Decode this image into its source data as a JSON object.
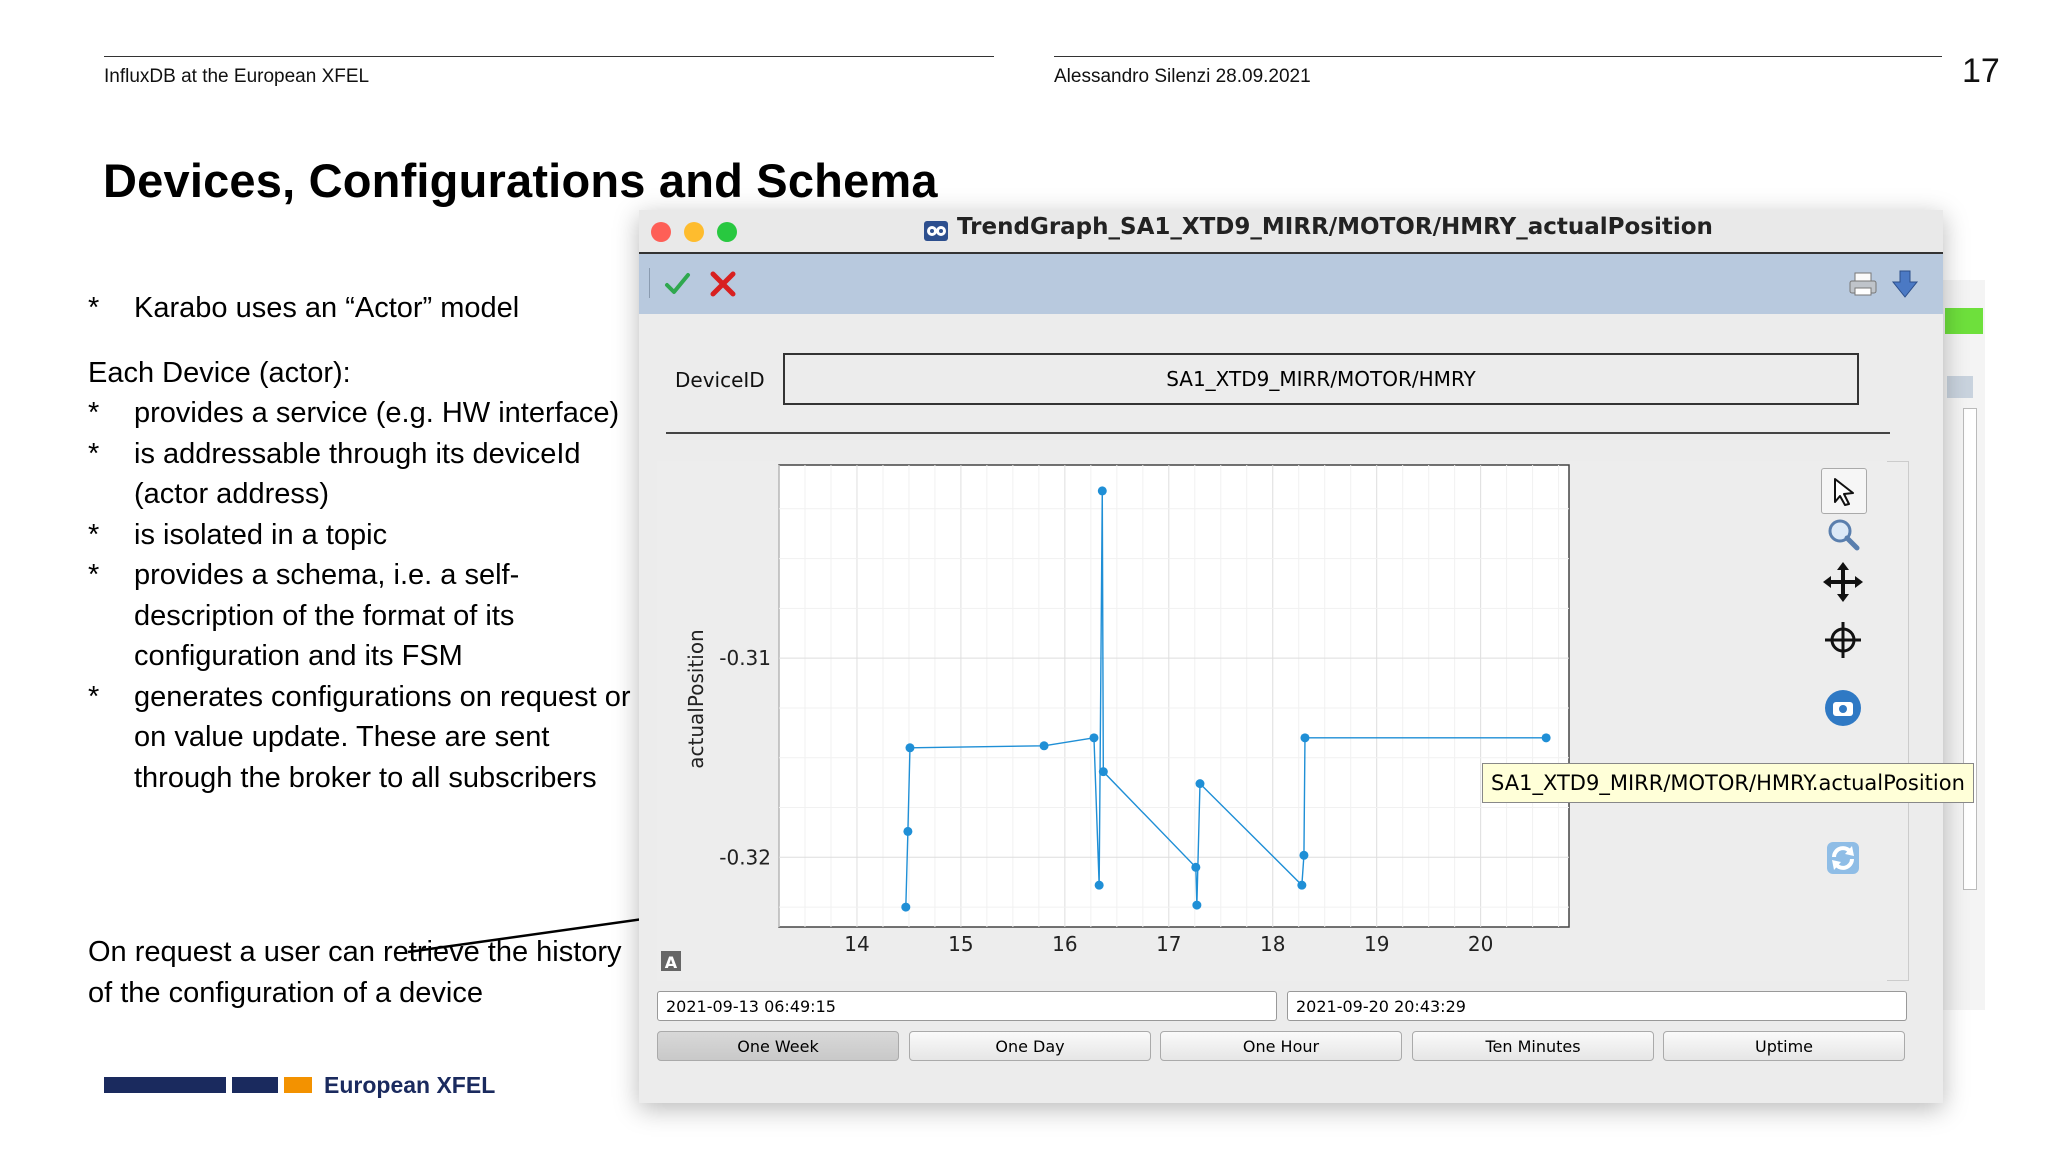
{
  "slide": {
    "header_left": "InfluxDB at the European XFEL",
    "header_right": "Alessandro Silenzi 28.09.2021",
    "page_number": "17",
    "title": "Devices, Configurations and Schema",
    "bullets": [
      {
        "marker": "*",
        "text": "Karabo uses an “Actor” model"
      },
      {
        "marker": "",
        "text": "Each Device (actor):"
      },
      {
        "marker": "*",
        "text": "provides a service (e.g. HW interface)"
      },
      {
        "marker": "*",
        "text": "is addressable through its deviceId (actor address)"
      },
      {
        "marker": "*",
        "text": "is isolated in a topic"
      },
      {
        "marker": "*",
        "text": "provides a schema, i.e. a self-description of the format of its configuration and its FSM"
      },
      {
        "marker": "*",
        "text": "generates configurations on request or on value update. These are sent through the broker to all subscribers"
      }
    ],
    "request_text": "On request a user can retrieve the history of the configuration of a device",
    "logo_text": "European XFEL",
    "logo_colors": {
      "navy": "#1a2a5e",
      "orange": "#f39200"
    }
  },
  "window": {
    "title": "TrendGraph_SA1_XTD9_MIRR/MOTOR/HMRY_actualPosition",
    "device_label": "DeviceID",
    "device_id": "SA1_XTD9_MIRR/MOTOR/HMRY",
    "tooltip": "SA1_XTD9_MIRR/MOTOR/HMRY.actualPosition",
    "start_time": "2021-09-13 06:49:15",
    "end_time": "2021-09-20 20:43:29",
    "buttons": [
      "One Week",
      "One Day",
      "One Hour",
      "Ten Minutes",
      "Uptime"
    ],
    "active_button": "One Week",
    "toolbar_icons": [
      "apply-check-icon",
      "cancel-x-icon",
      "printer-icon",
      "download-arrow-icon"
    ],
    "side_icons": [
      "pointer-icon",
      "zoom-icon",
      "move-icon",
      "crosshair-icon",
      "camera-icon",
      "refresh-icon"
    ],
    "autorange_glyph": "A"
  },
  "chart_data": {
    "type": "line",
    "title": "",
    "xlabel": "",
    "ylabel": "actualPosition",
    "xlim": [
      13.25,
      20.85
    ],
    "ylim": [
      -0.3235,
      -0.3003
    ],
    "x_ticks": [
      "14",
      "15",
      "16",
      "17",
      "18",
      "19",
      "20"
    ],
    "y_ticks": [
      "-0.31",
      "-0.32"
    ],
    "grid": true,
    "color": "#1f8fd6",
    "series": [
      {
        "x": [
          14.47,
          14.49,
          14.51,
          15.8,
          16.28,
          16.33,
          16.36,
          16.37,
          17.26,
          17.27,
          17.3,
          18.28,
          18.3,
          18.31,
          20.63
        ],
        "y": [
          -0.3225,
          -0.3187,
          -0.3145,
          -0.3144,
          -0.314,
          -0.3214,
          -0.3016,
          -0.3157,
          -0.3205,
          -0.3224,
          -0.3163,
          -0.3214,
          -0.3199,
          -0.314,
          -0.314
        ]
      }
    ]
  }
}
